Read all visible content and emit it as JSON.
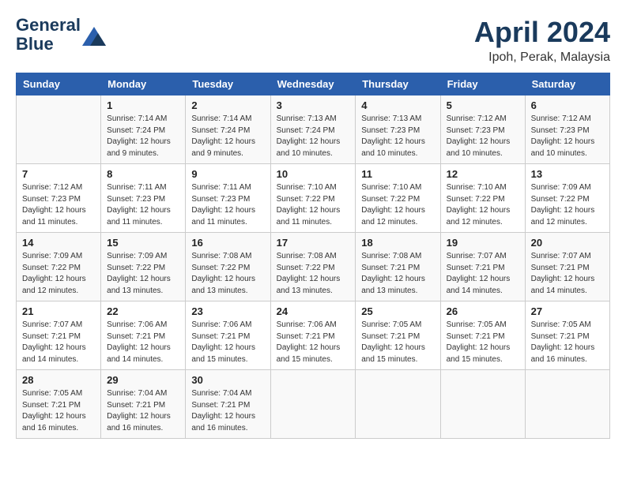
{
  "header": {
    "logo_line1": "General",
    "logo_line2": "Blue",
    "month": "April 2024",
    "location": "Ipoh, Perak, Malaysia"
  },
  "weekdays": [
    "Sunday",
    "Monday",
    "Tuesday",
    "Wednesday",
    "Thursday",
    "Friday",
    "Saturday"
  ],
  "weeks": [
    [
      {
        "day": "",
        "sunrise": "",
        "sunset": "",
        "daylight": ""
      },
      {
        "day": "1",
        "sunrise": "Sunrise: 7:14 AM",
        "sunset": "Sunset: 7:24 PM",
        "daylight": "Daylight: 12 hours and 9 minutes."
      },
      {
        "day": "2",
        "sunrise": "Sunrise: 7:14 AM",
        "sunset": "Sunset: 7:24 PM",
        "daylight": "Daylight: 12 hours and 9 minutes."
      },
      {
        "day": "3",
        "sunrise": "Sunrise: 7:13 AM",
        "sunset": "Sunset: 7:24 PM",
        "daylight": "Daylight: 12 hours and 10 minutes."
      },
      {
        "day": "4",
        "sunrise": "Sunrise: 7:13 AM",
        "sunset": "Sunset: 7:23 PM",
        "daylight": "Daylight: 12 hours and 10 minutes."
      },
      {
        "day": "5",
        "sunrise": "Sunrise: 7:12 AM",
        "sunset": "Sunset: 7:23 PM",
        "daylight": "Daylight: 12 hours and 10 minutes."
      },
      {
        "day": "6",
        "sunrise": "Sunrise: 7:12 AM",
        "sunset": "Sunset: 7:23 PM",
        "daylight": "Daylight: 12 hours and 10 minutes."
      }
    ],
    [
      {
        "day": "7",
        "sunrise": "Sunrise: 7:12 AM",
        "sunset": "Sunset: 7:23 PM",
        "daylight": "Daylight: 12 hours and 11 minutes."
      },
      {
        "day": "8",
        "sunrise": "Sunrise: 7:11 AM",
        "sunset": "Sunset: 7:23 PM",
        "daylight": "Daylight: 12 hours and 11 minutes."
      },
      {
        "day": "9",
        "sunrise": "Sunrise: 7:11 AM",
        "sunset": "Sunset: 7:23 PM",
        "daylight": "Daylight: 12 hours and 11 minutes."
      },
      {
        "day": "10",
        "sunrise": "Sunrise: 7:10 AM",
        "sunset": "Sunset: 7:22 PM",
        "daylight": "Daylight: 12 hours and 11 minutes."
      },
      {
        "day": "11",
        "sunrise": "Sunrise: 7:10 AM",
        "sunset": "Sunset: 7:22 PM",
        "daylight": "Daylight: 12 hours and 12 minutes."
      },
      {
        "day": "12",
        "sunrise": "Sunrise: 7:10 AM",
        "sunset": "Sunset: 7:22 PM",
        "daylight": "Daylight: 12 hours and 12 minutes."
      },
      {
        "day": "13",
        "sunrise": "Sunrise: 7:09 AM",
        "sunset": "Sunset: 7:22 PM",
        "daylight": "Daylight: 12 hours and 12 minutes."
      }
    ],
    [
      {
        "day": "14",
        "sunrise": "Sunrise: 7:09 AM",
        "sunset": "Sunset: 7:22 PM",
        "daylight": "Daylight: 12 hours and 12 minutes."
      },
      {
        "day": "15",
        "sunrise": "Sunrise: 7:09 AM",
        "sunset": "Sunset: 7:22 PM",
        "daylight": "Daylight: 12 hours and 13 minutes."
      },
      {
        "day": "16",
        "sunrise": "Sunrise: 7:08 AM",
        "sunset": "Sunset: 7:22 PM",
        "daylight": "Daylight: 12 hours and 13 minutes."
      },
      {
        "day": "17",
        "sunrise": "Sunrise: 7:08 AM",
        "sunset": "Sunset: 7:22 PM",
        "daylight": "Daylight: 12 hours and 13 minutes."
      },
      {
        "day": "18",
        "sunrise": "Sunrise: 7:08 AM",
        "sunset": "Sunset: 7:21 PM",
        "daylight": "Daylight: 12 hours and 13 minutes."
      },
      {
        "day": "19",
        "sunrise": "Sunrise: 7:07 AM",
        "sunset": "Sunset: 7:21 PM",
        "daylight": "Daylight: 12 hours and 14 minutes."
      },
      {
        "day": "20",
        "sunrise": "Sunrise: 7:07 AM",
        "sunset": "Sunset: 7:21 PM",
        "daylight": "Daylight: 12 hours and 14 minutes."
      }
    ],
    [
      {
        "day": "21",
        "sunrise": "Sunrise: 7:07 AM",
        "sunset": "Sunset: 7:21 PM",
        "daylight": "Daylight: 12 hours and 14 minutes."
      },
      {
        "day": "22",
        "sunrise": "Sunrise: 7:06 AM",
        "sunset": "Sunset: 7:21 PM",
        "daylight": "Daylight: 12 hours and 14 minutes."
      },
      {
        "day": "23",
        "sunrise": "Sunrise: 7:06 AM",
        "sunset": "Sunset: 7:21 PM",
        "daylight": "Daylight: 12 hours and 15 minutes."
      },
      {
        "day": "24",
        "sunrise": "Sunrise: 7:06 AM",
        "sunset": "Sunset: 7:21 PM",
        "daylight": "Daylight: 12 hours and 15 minutes."
      },
      {
        "day": "25",
        "sunrise": "Sunrise: 7:05 AM",
        "sunset": "Sunset: 7:21 PM",
        "daylight": "Daylight: 12 hours and 15 minutes."
      },
      {
        "day": "26",
        "sunrise": "Sunrise: 7:05 AM",
        "sunset": "Sunset: 7:21 PM",
        "daylight": "Daylight: 12 hours and 15 minutes."
      },
      {
        "day": "27",
        "sunrise": "Sunrise: 7:05 AM",
        "sunset": "Sunset: 7:21 PM",
        "daylight": "Daylight: 12 hours and 16 minutes."
      }
    ],
    [
      {
        "day": "28",
        "sunrise": "Sunrise: 7:05 AM",
        "sunset": "Sunset: 7:21 PM",
        "daylight": "Daylight: 12 hours and 16 minutes."
      },
      {
        "day": "29",
        "sunrise": "Sunrise: 7:04 AM",
        "sunset": "Sunset: 7:21 PM",
        "daylight": "Daylight: 12 hours and 16 minutes."
      },
      {
        "day": "30",
        "sunrise": "Sunrise: 7:04 AM",
        "sunset": "Sunset: 7:21 PM",
        "daylight": "Daylight: 12 hours and 16 minutes."
      },
      {
        "day": "",
        "sunrise": "",
        "sunset": "",
        "daylight": ""
      },
      {
        "day": "",
        "sunrise": "",
        "sunset": "",
        "daylight": ""
      },
      {
        "day": "",
        "sunrise": "",
        "sunset": "",
        "daylight": ""
      },
      {
        "day": "",
        "sunrise": "",
        "sunset": "",
        "daylight": ""
      }
    ]
  ]
}
